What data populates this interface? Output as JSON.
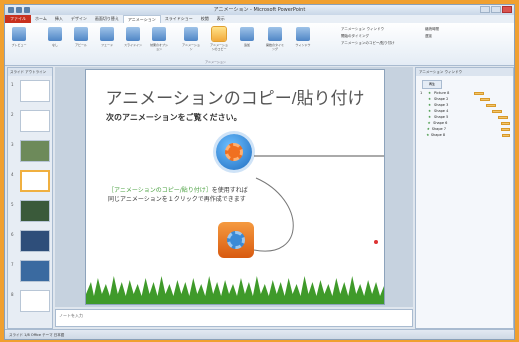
{
  "window": {
    "title": "アニメーション - Microsoft PowerPoint"
  },
  "ribbon_tabs": [
    {
      "label": "ファイル"
    },
    {
      "label": "ホーム"
    },
    {
      "label": "挿入"
    },
    {
      "label": "デザイン"
    },
    {
      "label": "画面切り替え"
    },
    {
      "label": "アニメーション",
      "active": true
    },
    {
      "label": "スライドショー"
    },
    {
      "label": "校閲"
    },
    {
      "label": "表示"
    }
  ],
  "ribbon": {
    "buttons": [
      {
        "label": "プレビュー"
      },
      {
        "label": "なし"
      },
      {
        "label": "アピール"
      },
      {
        "label": "フェード"
      },
      {
        "label": "スライドイン"
      },
      {
        "label": "効果のオプション"
      },
      {
        "label": "アニメーション"
      },
      {
        "label": "アニメーションのコピー"
      },
      {
        "label": "追加"
      },
      {
        "label": "開始のタイミング"
      },
      {
        "label": "ウィンドウ"
      }
    ],
    "right_text": [
      "アニメーション ウィンドウ",
      "開始のタイミング",
      "アニメーションのコピー/貼り付け",
      "継続時間",
      "遅延"
    ],
    "group_label": "アニメーション"
  },
  "slides_panel": {
    "header": "スライド アウトライン",
    "thumb_numbers": [
      "1",
      "2",
      "3",
      "4",
      "5",
      "6",
      "7",
      "8"
    ]
  },
  "slide": {
    "title": "アニメーションのコピー/貼り付け",
    "subtitle": "次のアニメーションをご覧ください。",
    "desc_highlight": "［アニメーションのコピー/貼り付け］",
    "desc_line1_rest": "を使用すれば",
    "desc_line2": "同じアニメーションを１クリックで再作成できます"
  },
  "notes": {
    "placeholder": "ノートを入力"
  },
  "animation_pane": {
    "header": "アニメーション ウィンドウ",
    "play_label": "再生",
    "items": [
      {
        "n": "1",
        "name": "Picture 8"
      },
      {
        "n": "",
        "name": "Shape 2"
      },
      {
        "n": "",
        "name": "Shape 3"
      },
      {
        "n": "",
        "name": "Shape 4"
      },
      {
        "n": "",
        "name": "Shape 5"
      },
      {
        "n": "",
        "name": "Shape 6"
      },
      {
        "n": "",
        "name": "Shape 7"
      },
      {
        "n": "",
        "name": "Shape 8"
      }
    ]
  },
  "status": {
    "text": "スライド 1/8  Office テーマ  日本語"
  }
}
